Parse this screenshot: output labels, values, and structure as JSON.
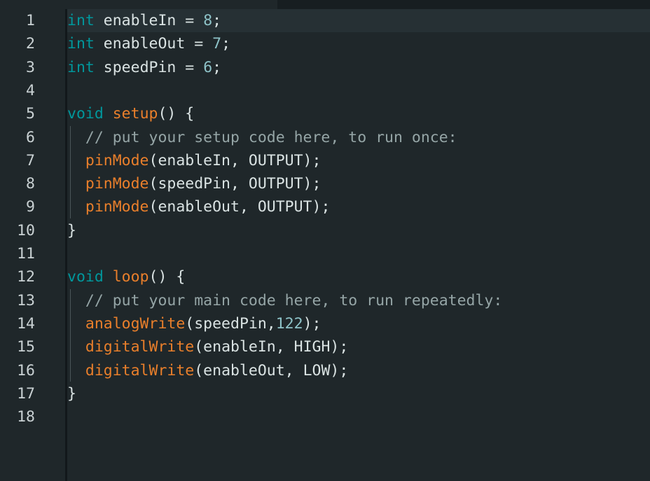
{
  "editor": {
    "line_numbers": [
      "1",
      "2",
      "3",
      "4",
      "5",
      "6",
      "7",
      "8",
      "9",
      "10",
      "11",
      "12",
      "13",
      "14",
      "15",
      "16",
      "17",
      "18"
    ],
    "lines": [
      [
        {
          "t": "int",
          "c": "kw"
        },
        {
          "t": " enableIn = ",
          "c": "id"
        },
        {
          "t": "8",
          "c": "num"
        },
        {
          "t": ";",
          "c": "pun"
        }
      ],
      [
        {
          "t": "int",
          "c": "kw"
        },
        {
          "t": " enableOut = ",
          "c": "id"
        },
        {
          "t": "7",
          "c": "num"
        },
        {
          "t": ";",
          "c": "pun"
        }
      ],
      [
        {
          "t": "int",
          "c": "kw"
        },
        {
          "t": " speedPin = ",
          "c": "id"
        },
        {
          "t": "6",
          "c": "num"
        },
        {
          "t": ";",
          "c": "pun"
        }
      ],
      [],
      [
        {
          "t": "void",
          "c": "kw"
        },
        {
          "t": " ",
          "c": "id"
        },
        {
          "t": "setup",
          "c": "fn"
        },
        {
          "t": "() {",
          "c": "pun"
        }
      ],
      [
        {
          "t": "  ",
          "c": "id"
        },
        {
          "t": "// put your setup code here, to run once:",
          "c": "cm"
        }
      ],
      [
        {
          "t": "  ",
          "c": "id"
        },
        {
          "t": "pinMode",
          "c": "fn"
        },
        {
          "t": "(enableIn, OUTPUT);",
          "c": "id"
        }
      ],
      [
        {
          "t": "  ",
          "c": "id"
        },
        {
          "t": "pinMode",
          "c": "fn"
        },
        {
          "t": "(speedPin, OUTPUT);",
          "c": "id"
        }
      ],
      [
        {
          "t": "  ",
          "c": "id"
        },
        {
          "t": "pinMode",
          "c": "fn"
        },
        {
          "t": "(enableOut, OUTPUT);",
          "c": "id"
        }
      ],
      [
        {
          "t": "}",
          "c": "pun"
        }
      ],
      [],
      [
        {
          "t": "void",
          "c": "kw"
        },
        {
          "t": " ",
          "c": "id"
        },
        {
          "t": "loop",
          "c": "fn"
        },
        {
          "t": "() {",
          "c": "pun"
        }
      ],
      [
        {
          "t": "  ",
          "c": "id"
        },
        {
          "t": "// put your main code here, to run repeatedly:",
          "c": "cm"
        }
      ],
      [
        {
          "t": "  ",
          "c": "id"
        },
        {
          "t": "analogWrite",
          "c": "fn"
        },
        {
          "t": "(speedPin,",
          "c": "id"
        },
        {
          "t": "122",
          "c": "num"
        },
        {
          "t": ");",
          "c": "pun"
        }
      ],
      [
        {
          "t": "  ",
          "c": "id"
        },
        {
          "t": "digitalWrite",
          "c": "fn"
        },
        {
          "t": "(enableIn, HIGH);",
          "c": "id"
        }
      ],
      [
        {
          "t": "  ",
          "c": "id"
        },
        {
          "t": "digitalWrite",
          "c": "fn"
        },
        {
          "t": "(enableOut, LOW);",
          "c": "id"
        }
      ],
      [
        {
          "t": "}",
          "c": "pun"
        }
      ],
      []
    ]
  },
  "colors": {
    "background": "#1f272a",
    "keyword": "#00979c",
    "function": "#e97f2b",
    "number": "#8ec3c8",
    "comment": "#95a5a6",
    "text": "#dae3e3"
  }
}
